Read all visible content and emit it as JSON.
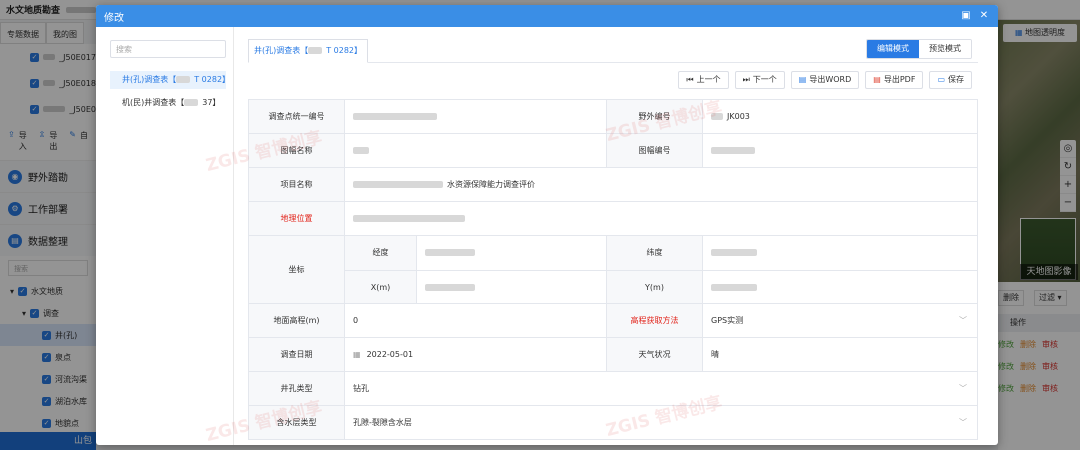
{
  "background": {
    "app_title": "水文地质勘查",
    "tabs": [
      "专题数据",
      "我的图"
    ],
    "layers": [
      "_J50E017",
      "_J50E018",
      "_J50E0"
    ],
    "tools": {
      "import": "导入",
      "export": "导出",
      "self": "自"
    },
    "sections": [
      "野外踏勘",
      "工作部署",
      "数据整理"
    ],
    "search_placeholder": "搜索",
    "tree": [
      "水文地质",
      "调查",
      "井(孔)",
      "泉点",
      "河流沟渠",
      "湖泊水库",
      "地貌点"
    ],
    "bottom_button": "山包",
    "map_transparency": "地图透明度",
    "map_label": "天地图影像",
    "zoom": [
      "◎",
      "↻",
      "+",
      "−"
    ],
    "table_buttons": {
      "delete": "删除",
      "filter": "过滤"
    },
    "table_header": "操作",
    "table_ops": {
      "edit": "修改",
      "delete": "删除",
      "audit": "审核"
    }
  },
  "modal": {
    "title": "修改",
    "side_search_placeholder": "搜索",
    "side_items": [
      {
        "prefix": "井(孔)调查表【",
        "suffix": "T 0282】"
      },
      {
        "prefix": "机(民)井调查表【",
        "suffix": "37】"
      }
    ],
    "tab_label_prefix": "井(孔)调查表【",
    "tab_label_suffix": "T 0282】",
    "modes": {
      "edit": "编辑模式",
      "preview": "预览模式"
    },
    "toolbar": {
      "prev": "上一个",
      "next": "下一个",
      "word": "导出WORD",
      "pdf": "导出PDF",
      "save": "保存"
    },
    "form": {
      "survey_id_label": "调查点统一编号",
      "field_id_label": "野外编号",
      "field_id_value": "JK003",
      "map_name_label": "图幅名称",
      "map_no_label": "图幅编号",
      "project_label": "项目名称",
      "project_value": "水资源保障能力调查评价",
      "location_label": "地理位置",
      "coord_label": "坐标",
      "lng_label": "经度",
      "lat_label": "纬度",
      "x_label": "X(m)",
      "y_label": "Y(m)",
      "elevation_label": "地面高程(m)",
      "elevation_value": "0",
      "elev_method_label": "高程获取方法",
      "elev_method_value": "GPS实测",
      "date_label": "调查日期",
      "date_value": "2022-05-01",
      "weather_label": "天气状况",
      "weather_value": "晴",
      "well_type_label": "井孔类型",
      "well_type_value": "钻孔",
      "aquifer_label": "含水层类型",
      "aquifer_value": "孔隙-裂隙含水层"
    },
    "watermark": "ZGIS 智博创享"
  }
}
